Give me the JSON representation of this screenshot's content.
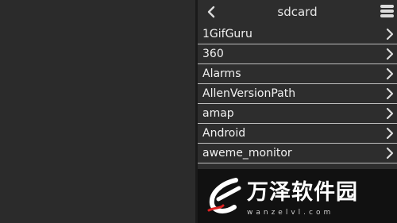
{
  "header": {
    "title": "sdcard",
    "back_icon": "chevron-left-icon",
    "menu_icon": "hamburger-menu-icon"
  },
  "folders": [
    {
      "label": "1GifGuru"
    },
    {
      "label": "360"
    },
    {
      "label": "Alarms"
    },
    {
      "label": "AllenVersionPath"
    },
    {
      "label": "amap"
    },
    {
      "label": "Android"
    },
    {
      "label": "aweme_monitor"
    }
  ],
  "watermark": {
    "title": "万泽软件园",
    "url": "wanzelvl.com"
  },
  "colors": {
    "background": "#2b2b2b",
    "text": "#f2f2f2",
    "separator": "#bdbdbd",
    "watermark_bg": "#111111"
  }
}
